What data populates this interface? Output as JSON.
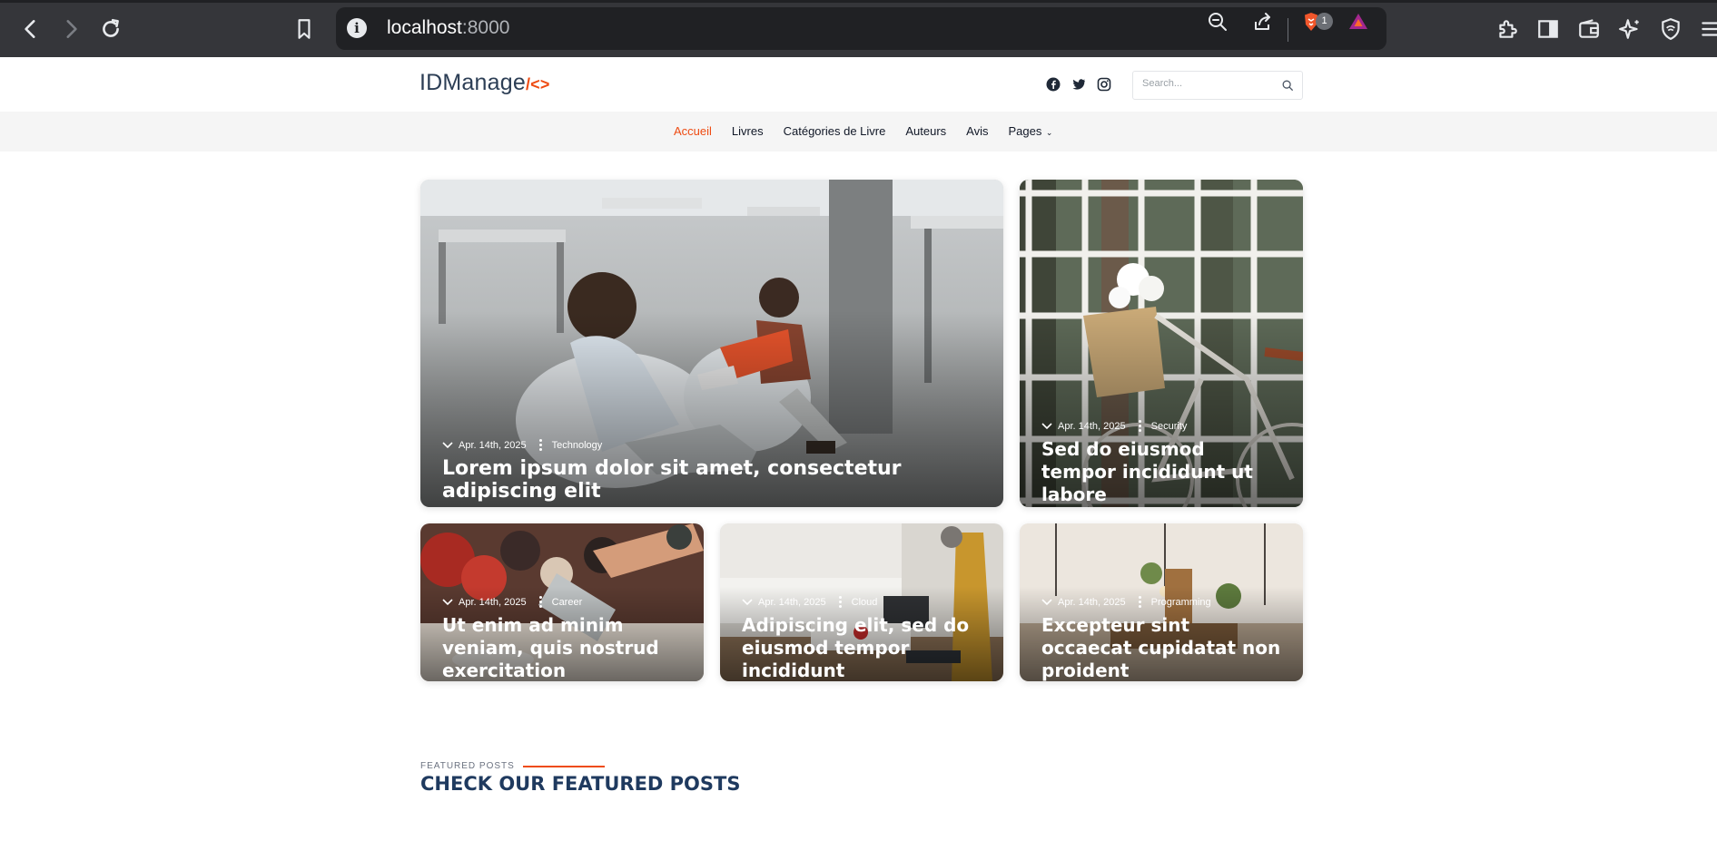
{
  "browser": {
    "url_host": "localhost",
    "url_port": ":8000",
    "extension_badge": "1"
  },
  "site": {
    "logo_text": "IDManage",
    "logo_mark": "/<>",
    "search_placeholder": "Search...",
    "social_icons": [
      "facebook-icon",
      "twitter-icon",
      "instagram-icon"
    ]
  },
  "nav": {
    "items": [
      {
        "label": "Accueil",
        "active": true
      },
      {
        "label": "Livres"
      },
      {
        "label": "Catégories de Livre"
      },
      {
        "label": "Auteurs"
      },
      {
        "label": "Avis"
      },
      {
        "label": "Pages",
        "dropdown": true
      }
    ]
  },
  "posts": [
    {
      "date": "Apr. 14th, 2025",
      "category": "Technology",
      "title": "Lorem ipsum dolor sit amet, consectetur adipiscing elit"
    },
    {
      "date": "Apr. 14th, 2025",
      "category": "Security",
      "title": "Sed do eiusmod tempor incididunt ut labore"
    },
    {
      "date": "Apr. 14th, 2025",
      "category": "Career",
      "title": "Ut enim ad minim veniam, quis nostrud exercitation"
    },
    {
      "date": "Apr. 14th, 2025",
      "category": "Cloud",
      "title": "Adipiscing elit, sed do eiusmod tempor incididunt"
    },
    {
      "date": "Apr. 14th, 2025",
      "category": "Programming",
      "title": "Excepteur sint occaecat cupidatat non proident"
    }
  ],
  "featured": {
    "eyebrow": "FEATURED POSTS",
    "title": "CHECK OUR FEATURED POSTS"
  },
  "colors": {
    "accent": "#ee4b12",
    "heading": "#1f3a5f",
    "chrome_bg": "#35363a"
  }
}
